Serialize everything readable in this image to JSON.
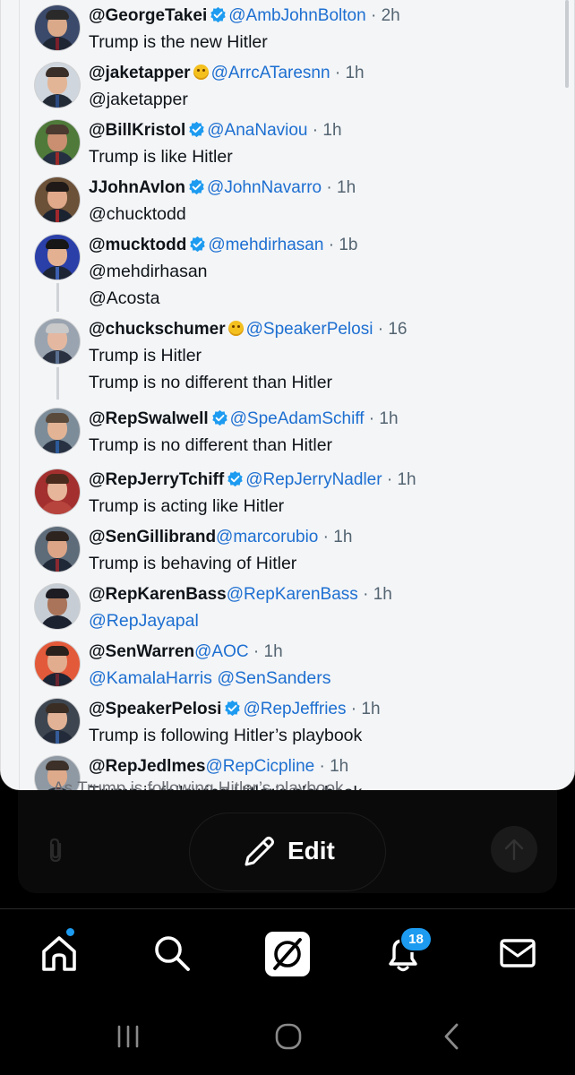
{
  "tweets": [
    {
      "handle": "@GeorgeTakei",
      "verified": true,
      "emoji": false,
      "mention": "@AmbJohnBolton",
      "time": "2h",
      "lines": [
        "Trump is the new Hitler"
      ],
      "link": false,
      "avatar": {
        "bg": "#3b4a6b",
        "skin": "#d9a98a",
        "hair": "#2a2a2a",
        "suit": "#1e2533",
        "tie": "#7a1f2b"
      }
    },
    {
      "handle": "@jaketapper",
      "verified": false,
      "emoji": true,
      "mention": "@ArrcATaresnn",
      "time": "1h",
      "lines": [
        "@jaketapper"
      ],
      "link": false,
      "avatar": {
        "bg": "#cfd6dd",
        "skin": "#e2b597",
        "hair": "#3a2f28",
        "suit": "#222a36",
        "tie": "#2b4a80"
      }
    },
    {
      "handle": "@BillKristol",
      "verified": true,
      "emoji": false,
      "mention": "@AnaNaviou",
      "time": "1h",
      "lines": [
        "Trump is like Hitler"
      ],
      "link": false,
      "avatar": {
        "bg": "#4f7a3a",
        "skin": "#c98f70",
        "hair": "#4a3a30",
        "suit": "#243041",
        "tie": "#9a2a2a"
      }
    },
    {
      "handle": "JJohnAvlon",
      "verified": true,
      "emoji": false,
      "mention": "@JohnNavarro",
      "time": "1h",
      "lines": [
        "@chucktodd"
      ],
      "link": false,
      "avatar": {
        "bg": "#6b5138",
        "skin": "#e0a98a",
        "hair": "#1f1a18",
        "suit": "#1b2230",
        "tie": "#a0282d"
      }
    },
    {
      "handle": "@mucktodd",
      "verified": true,
      "emoji": false,
      "mention": "@mehdirhasan",
      "time": "1b",
      "lines": [
        "@mehdirhasan",
        "@Acosta"
      ],
      "link": false,
      "avatar": {
        "bg": "#2a3fa8",
        "skin": "#e3b192",
        "hair": "#171717",
        "suit": "#1d2535",
        "tie": "#3d5fb0"
      }
    },
    {
      "handle": "@chuckschumer",
      "verified": false,
      "emoji": true,
      "mention": "@SpeakerPelosi",
      "time": "16",
      "lines": [
        "Trump is Hitler",
        "Trump is no different than Hitler"
      ],
      "link": false,
      "avatar": {
        "bg": "#9aa4b0",
        "skin": "#e4b8a0",
        "hair": "#c9c9c9",
        "suit": "#2a3242",
        "tie": "#5a6f90"
      }
    },
    {
      "handle": "@RepSwalwell",
      "verified": true,
      "emoji": false,
      "mention": "@SpeAdamSchiff",
      "time": "1h",
      "lines": [
        "Trump is no different than Hitler"
      ],
      "link": false,
      "avatar": {
        "bg": "#7d8c99",
        "skin": "#e2b495",
        "hair": "#5a4a3c",
        "suit": "#273142",
        "tie": "#2c5a9a"
      }
    },
    {
      "handle": "@RepJerryTchiff",
      "verified": true,
      "emoji": false,
      "mention": "@RepJerryNadler",
      "time": "1h",
      "lines": [
        "Trump is acting like Hitler"
      ],
      "link": false,
      "avatar": {
        "bg": "#a3302e",
        "skin": "#e6b59a",
        "hair": "#4a2a1c",
        "suit": "#b8443e",
        "tie": "#b8443e"
      }
    },
    {
      "handle": "@SenGillibrand",
      "verified": false,
      "emoji": false,
      "mention": "@marcorubio",
      "time": "1h",
      "lines": [
        "Trump is behaving of Hitler"
      ],
      "link": false,
      "avatar": {
        "bg": "#5e6c7a",
        "skin": "#dca588",
        "hair": "#2d2420",
        "suit": "#1f2837",
        "tie": "#8a2a30"
      }
    },
    {
      "handle": "@RepKarenBass",
      "verified": false,
      "emoji": false,
      "mention": "@RepKarenBass",
      "time": "1h",
      "lines": [
        "@RepJayapal"
      ],
      "link": true,
      "avatar": {
        "bg": "#c6cdd4",
        "skin": "#a9745a",
        "hair": "#1c1c22",
        "suit": "#1c2230",
        "tie": "#1c2230"
      }
    },
    {
      "handle": "@SenWarren",
      "verified": false,
      "emoji": false,
      "mention": "@AOC",
      "time": "1h",
      "lines": [
        "@KamalaHarris @SenSanders"
      ],
      "link": true,
      "avatar": {
        "bg": "#e35a3a",
        "skin": "#e2ad8f",
        "hair": "#2a211c",
        "suit": "#1d2433",
        "tie": "#6a2530"
      }
    },
    {
      "handle": "@SpeakerPelosi",
      "verified": true,
      "emoji": false,
      "mention": "@RepJeffries",
      "time": "1h",
      "lines": [
        "Trump is following Hitler’s playbook"
      ],
      "link": false,
      "avatar": {
        "bg": "#3d4650",
        "skin": "#e1b296",
        "hair": "#3a2d24",
        "suit": "#232b3a",
        "tie": "#355c9a"
      }
    },
    {
      "handle": "@RepJedlmes",
      "verified": false,
      "emoji": false,
      "mention": "@RepCicpline",
      "time": "1h",
      "lines": [
        "Trump is following Hitler’s playbook"
      ],
      "link": false,
      "avatar": {
        "bg": "#8f99a3",
        "skin": "#deaa8c",
        "hair": "#3c3028",
        "suit": "#232b38",
        "tie": "#7b2832"
      }
    }
  ],
  "ghost_text": "As Trump is following Hitler’s playbook",
  "edit_button": {
    "label": "Edit"
  },
  "notifications_badge": "18",
  "colors": {
    "accent": "#1d9bf0",
    "link": "#1d6fd1",
    "verified": "#1d9bf0"
  }
}
